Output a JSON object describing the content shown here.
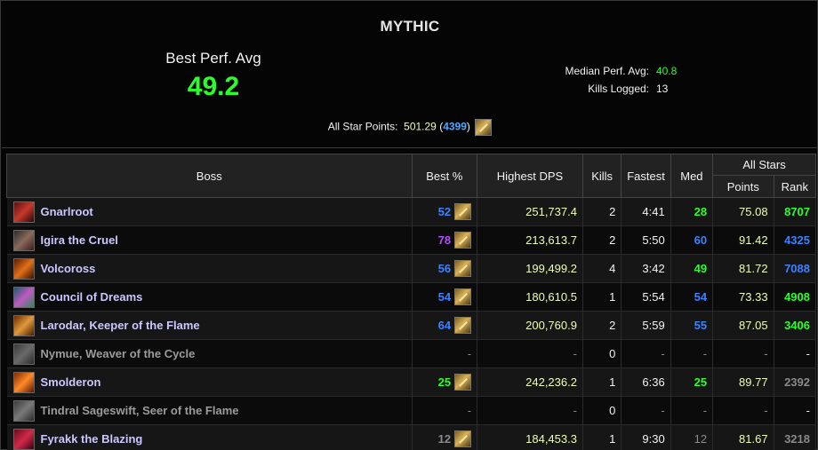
{
  "header": {
    "title": "MYTHIC",
    "best_perf_label": "Best Perf. Avg",
    "best_perf_value": "49.2",
    "median_label": "Median Perf. Avg:",
    "median_value": "40.8",
    "kills_label": "Kills Logged:",
    "kills_value": "13",
    "allstar_label": "All Star Points:",
    "allstar_points": "501.29",
    "allstar_open": "(",
    "allstar_rank": "4399",
    "allstar_close": ")"
  },
  "table": {
    "headers": {
      "boss": "Boss",
      "best": "Best %",
      "dps": "Highest DPS",
      "kills": "Kills",
      "fastest": "Fastest",
      "med": "Med",
      "allstars": "All Stars",
      "points": "Points",
      "rank": "Rank"
    },
    "rows": [
      {
        "boss": "Gnarlroot",
        "best": "52",
        "dps": "251,737.4",
        "kills": "2",
        "fastest": "4:41",
        "med": "28",
        "points": "75.08",
        "rank": "8707"
      },
      {
        "boss": "Igira the Cruel",
        "best": "78",
        "dps": "213,613.7",
        "kills": "2",
        "fastest": "5:50",
        "med": "60",
        "points": "91.42",
        "rank": "4325"
      },
      {
        "boss": "Volcoross",
        "best": "56",
        "dps": "199,499.2",
        "kills": "4",
        "fastest": "3:42",
        "med": "49",
        "points": "81.72",
        "rank": "7088"
      },
      {
        "boss": "Council of Dreams",
        "best": "54",
        "dps": "180,610.5",
        "kills": "1",
        "fastest": "5:54",
        "med": "54",
        "points": "73.33",
        "rank": "4908"
      },
      {
        "boss": "Larodar, Keeper of the Flame",
        "best": "64",
        "dps": "200,760.9",
        "kills": "2",
        "fastest": "5:59",
        "med": "55",
        "points": "87.05",
        "rank": "3406"
      },
      {
        "boss": "Nymue, Weaver of the Cycle",
        "best": "-",
        "dps": "-",
        "kills": "0",
        "fastest": "-",
        "med": "-",
        "points": "-",
        "rank": "-"
      },
      {
        "boss": "Smolderon",
        "best": "25",
        "dps": "242,236.2",
        "kills": "1",
        "fastest": "6:36",
        "med": "25",
        "points": "89.77",
        "rank": "2392"
      },
      {
        "boss": "Tindral Sageswift, Seer of the Flame",
        "best": "-",
        "dps": "-",
        "kills": "0",
        "fastest": "-",
        "med": "-",
        "points": "-",
        "rank": "-"
      },
      {
        "boss": "Fyrakk the Blazing",
        "best": "12",
        "dps": "184,453.3",
        "kills": "1",
        "fastest": "9:30",
        "med": "12",
        "points": "81.67",
        "rank": "3218"
      }
    ]
  },
  "colors": {
    "green": "#2bff2b",
    "blue": "#3b82ff",
    "purple": "#b44bff",
    "gray": "#8a8a8a",
    "dps_yellow": "#eaffb5",
    "boss_name": "#c8c8ff"
  }
}
